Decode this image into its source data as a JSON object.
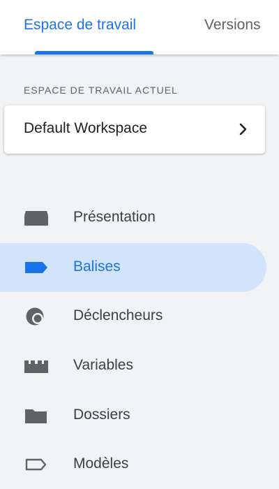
{
  "tabs": [
    {
      "label": "Espace de travail",
      "active": true
    },
    {
      "label": "Versions",
      "active": false
    }
  ],
  "workspace": {
    "section_label": "ESPACE DE TRAVAIL ACTUEL",
    "name": "Default Workspace"
  },
  "nav": {
    "items": [
      {
        "label": "Présentation",
        "icon": "overview-icon",
        "active": false
      },
      {
        "label": "Balises",
        "icon": "tag-icon",
        "active": true
      },
      {
        "label": "Déclencheurs",
        "icon": "trigger-icon",
        "active": false
      },
      {
        "label": "Variables",
        "icon": "variables-icon",
        "active": false
      },
      {
        "label": "Dossiers",
        "icon": "folder-icon",
        "active": false
      },
      {
        "label": "Modèles",
        "icon": "template-icon",
        "active": false
      }
    ]
  },
  "colors": {
    "accent": "#1a73e8",
    "active_bg": "#d2e3fc",
    "icon": "#5f6368",
    "text": "#3c4043",
    "background": "#f1f3f4"
  }
}
